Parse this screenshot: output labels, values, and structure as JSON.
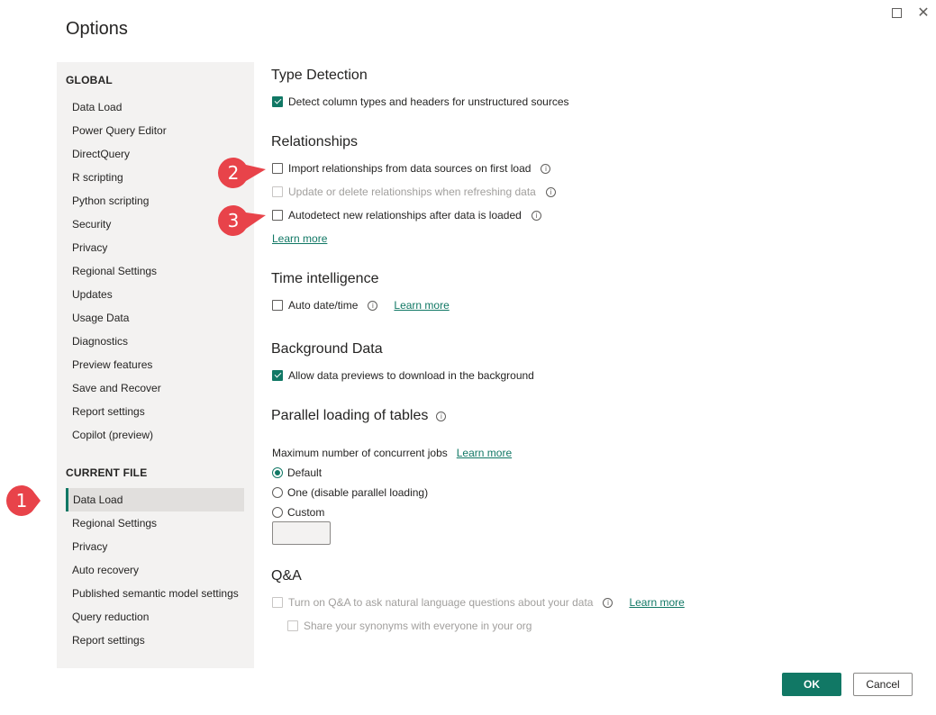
{
  "dialog": {
    "title": "Options",
    "maximize_icon": "maximize-icon",
    "close_icon": "close-icon"
  },
  "sidebar": {
    "global_label": "GLOBAL",
    "global_items": [
      "Data Load",
      "Power Query Editor",
      "DirectQuery",
      "R scripting",
      "Python scripting",
      "Security",
      "Privacy",
      "Regional Settings",
      "Updates",
      "Usage Data",
      "Diagnostics",
      "Preview features",
      "Save and Recover",
      "Report settings",
      "Copilot (preview)"
    ],
    "current_file_label": "CURRENT FILE",
    "current_file_items": [
      "Data Load",
      "Regional Settings",
      "Privacy",
      "Auto recovery",
      "Published semantic model settings",
      "Query reduction",
      "Report settings"
    ],
    "selected": "Data Load"
  },
  "type_detection": {
    "title": "Type Detection",
    "detect_label": "Detect column types and headers for unstructured sources",
    "detect_checked": true
  },
  "relationships": {
    "title": "Relationships",
    "import_label": "Import relationships from data sources on first load",
    "import_checked": false,
    "update_label": "Update or delete relationships when refreshing data",
    "update_checked": false,
    "autodetect_label": "Autodetect new relationships after data is loaded",
    "autodetect_checked": false,
    "learn_more": "Learn more"
  },
  "time_intelligence": {
    "title": "Time intelligence",
    "auto_label": "Auto date/time",
    "auto_checked": false,
    "learn_more": "Learn more"
  },
  "background_data": {
    "title": "Background Data",
    "allow_label": "Allow data previews to download in the background",
    "allow_checked": true
  },
  "parallel_loading": {
    "title": "Parallel loading of tables",
    "max_jobs_label": "Maximum number of concurrent jobs",
    "learn_more": "Learn more",
    "options": [
      "Default",
      "One (disable parallel loading)",
      "Custom"
    ],
    "selected": "Default",
    "custom_value": ""
  },
  "qa": {
    "title": "Q&A",
    "turn_on_label": "Turn on Q&A to ask natural language questions about your data",
    "turn_on_checked": false,
    "learn_more": "Learn more",
    "share_label": "Share your synonyms with everyone in your org",
    "share_checked": false
  },
  "buttons": {
    "ok": "OK",
    "cancel": "Cancel"
  },
  "callouts": [
    "1",
    "2",
    "3"
  ],
  "colors": {
    "accent": "#117865",
    "callout": "#e8434a",
    "sidebar_bg": "#f3f2f1"
  },
  "icons": {
    "info": "info-icon",
    "checkmark": "checkmark-icon"
  }
}
